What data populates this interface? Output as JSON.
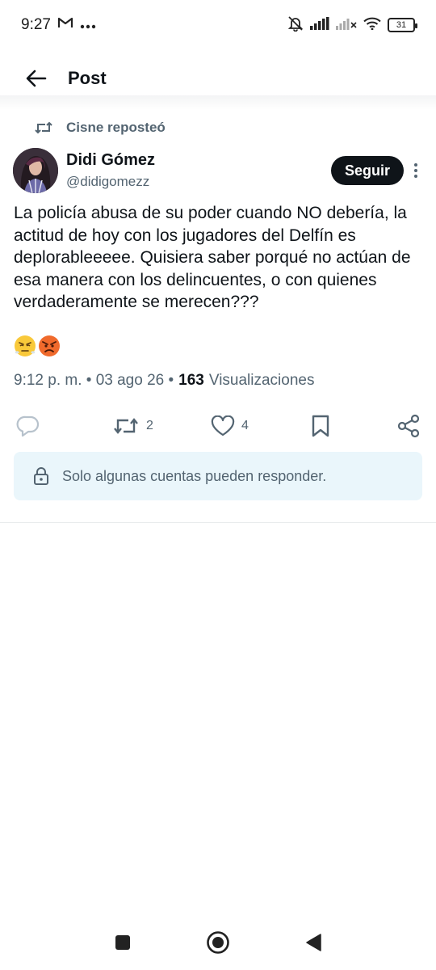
{
  "status_bar": {
    "time": "9:27",
    "battery": "31"
  },
  "header": {
    "title": "Post"
  },
  "repost": {
    "label": "Cisne reposteó"
  },
  "author": {
    "name": "Didi Gómez",
    "handle": "@didigomezz",
    "follow_label": "Seguir"
  },
  "tweet": {
    "text": "La policía abusa de su poder cuando NO debería, la actitud de hoy con los jugadores del Delfín es deplorableeeee. Quisiera saber porqué no actúan de esa manera con los delincuentes, o con quienes verdaderamente se merecen???",
    "emojis": [
      "triumph-face",
      "angry-face"
    ],
    "timestamp": "9:12 p. m. • 03 ago 26 •",
    "views_count": "163",
    "views_label": "Visualizaciones"
  },
  "actions": {
    "reply_count": "",
    "retweet_count": "2",
    "like_count": "4"
  },
  "restriction": {
    "text": "Solo algunas cuentas pueden responder."
  },
  "colors": {
    "text_primary": "#0f1419",
    "text_secondary": "#536471",
    "restrict_bg": "#eaf6fb",
    "follow_bg": "#0f1419"
  }
}
